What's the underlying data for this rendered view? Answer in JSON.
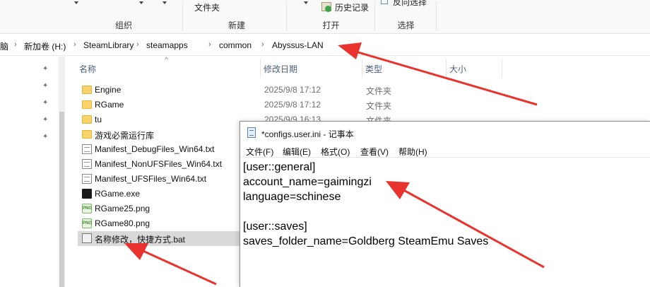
{
  "ribbon": {
    "groups": [
      {
        "label": "组织"
      },
      {
        "label": "新建"
      },
      {
        "label": "打开"
      },
      {
        "label": "选择"
      }
    ],
    "new_folder_label": "文件夹",
    "history_label": "历史记录",
    "invert_selection_label": "反向选择"
  },
  "address": {
    "crumbs": [
      "脑",
      "新加卷 (H:)",
      "SteamLibrary",
      "steamapps",
      "common",
      "Abyssus-LAN"
    ]
  },
  "columns": {
    "name": "名称",
    "modified": "修改日期",
    "type": "类型",
    "size": "大小"
  },
  "files": [
    {
      "name": "Engine",
      "date": "2025/9/8 17:12",
      "type": "文件夹",
      "icon": "folder-icon"
    },
    {
      "name": "RGame",
      "date": "2025/9/8 17:12",
      "type": "文件夹",
      "icon": "folder-icon"
    },
    {
      "name": "tu",
      "date": "2025/9/9 16:13",
      "type": "文件夹",
      "icon": "folder-icon"
    },
    {
      "name": "游戏必需运行库",
      "date": "",
      "type": "",
      "icon": "folder-icon"
    },
    {
      "name": "Manifest_DebugFiles_Win64.txt",
      "date": "",
      "type": "",
      "icon": "text-file-icon"
    },
    {
      "name": "Manifest_NonUFSFiles_Win64.txt",
      "date": "",
      "type": "",
      "icon": "text-file-icon"
    },
    {
      "name": "Manifest_UFSFiles_Win64.txt",
      "date": "",
      "type": "",
      "icon": "text-file-icon"
    },
    {
      "name": "RGame.exe",
      "date": "",
      "type": "",
      "icon": "exe-icon"
    },
    {
      "name": "RGame25.png",
      "date": "",
      "type": "",
      "icon": "png-icon"
    },
    {
      "name": "RGame80.png",
      "date": "",
      "type": "",
      "icon": "png-icon"
    },
    {
      "name": "名称修改，快捷方式.bat",
      "date": "",
      "type": "",
      "icon": "bat-icon"
    }
  ],
  "png_badge": "PNG",
  "notepad": {
    "title": "*configs.user.ini - 记事本",
    "menu": [
      "文件(F)",
      "编辑(E)",
      "格式(O)",
      "查看(V)",
      "帮助(H)"
    ],
    "content": "[user::general]\naccount_name=gaimingzi\nlanguage=schinese\n\n[user::saves]\nsaves_folder_name=Goldberg SteamEmu Saves"
  },
  "colors": {
    "annotation_arrow": "#e8332e",
    "folder": "#f8d46a",
    "selected_row": "#d9d9d9"
  }
}
